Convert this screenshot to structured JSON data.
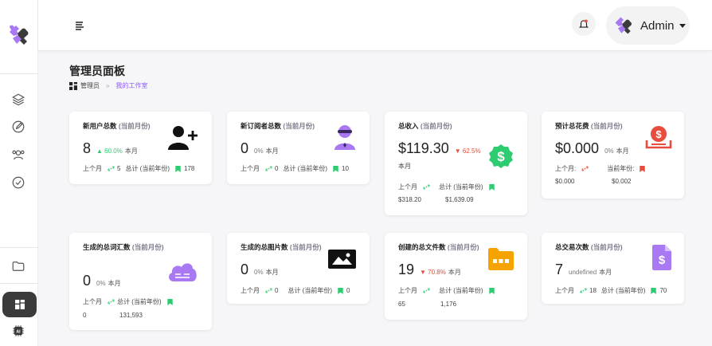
{
  "header": {
    "user_name": "Admin"
  },
  "page": {
    "title": "管理员面板",
    "breadcrumb": {
      "root": "管理员",
      "sep": "»",
      "current": "我的工作室"
    }
  },
  "cards": [
    {
      "title": "新用户总数",
      "sub": "(当前月份)",
      "value": "8",
      "change": "▲ 60.0%",
      "change_dir": "up",
      "period": "本月",
      "last_month_label": "上个月",
      "last_month": "5",
      "total_label": "总计 (当前年份)",
      "total": "178",
      "icon": "user-plus-icon"
    },
    {
      "title": "新订阅者总数",
      "sub": "(当前月份)",
      "value": "0",
      "change": "0%",
      "change_dir": "zero",
      "period": "本月",
      "last_month_label": "上个月",
      "last_month": "0",
      "total_label": "总计 (当前年份)",
      "total": "10",
      "icon": "subscriber-icon"
    },
    {
      "title": "总收入",
      "sub": "(当前月份)",
      "value": "$119.30",
      "change": "▼ 62.5%",
      "change_dir": "down",
      "period": "本月",
      "last_month_label": "上个月",
      "last_month": "$318.20",
      "total_label": "总计 (当前年份)",
      "total": "$1,639.09",
      "icon": "dollar-badge-icon"
    },
    {
      "title": "预计总花费",
      "sub": "(当前月份)",
      "value": "$0.000",
      "change": "0%",
      "change_dir": "zero",
      "period": "本月",
      "last_month_label": "上个月:",
      "last_month": "$0.000",
      "total_label": "当前年份:",
      "total": "$0.002",
      "icon": "spending-icon"
    },
    {
      "title": "生成的总词汇数",
      "sub": "(当前月份)",
      "value": "0",
      "change": "0%",
      "change_dir": "zero",
      "period": "本月",
      "last_month_label": "上个月",
      "last_month": "0",
      "total_label": "总计 (当前年份)",
      "total": "131,593",
      "icon": "cloud-icon"
    },
    {
      "title": "生成的总图片数",
      "sub": "(当前月份)",
      "value": "0",
      "change": "0%",
      "change_dir": "zero",
      "period": "本月",
      "last_month_label": "上个月",
      "last_month": "0",
      "total_label": "总计 (当前年份)",
      "total": "0",
      "icon": "image-icon"
    },
    {
      "title": "创建的总文件数",
      "sub": "(当前月份)",
      "value": "19",
      "change": "▼ 70.8%",
      "change_dir": "down",
      "period": "本月",
      "last_month_label": "上个月",
      "last_month": "65",
      "total_label": "总计 (当前年份)",
      "total": "1,176",
      "icon": "folder-icon"
    },
    {
      "title": "总交易次数",
      "sub": "(当前月份)",
      "value": "7",
      "change": "undefined",
      "change_dir": "zero",
      "period": "本月",
      "last_month_label": "上个月",
      "last_month": "18",
      "total_label": "总计 (当前年份)",
      "total": "70",
      "icon": "invoice-icon"
    }
  ],
  "colors": {
    "accent": "#8a5cf6",
    "up": "#2ecc71",
    "down": "#e74c3c",
    "success_badge": "#2ecc71",
    "danger": "#e74c3c",
    "folder": "#f5a300",
    "purple": "#a879f2"
  }
}
